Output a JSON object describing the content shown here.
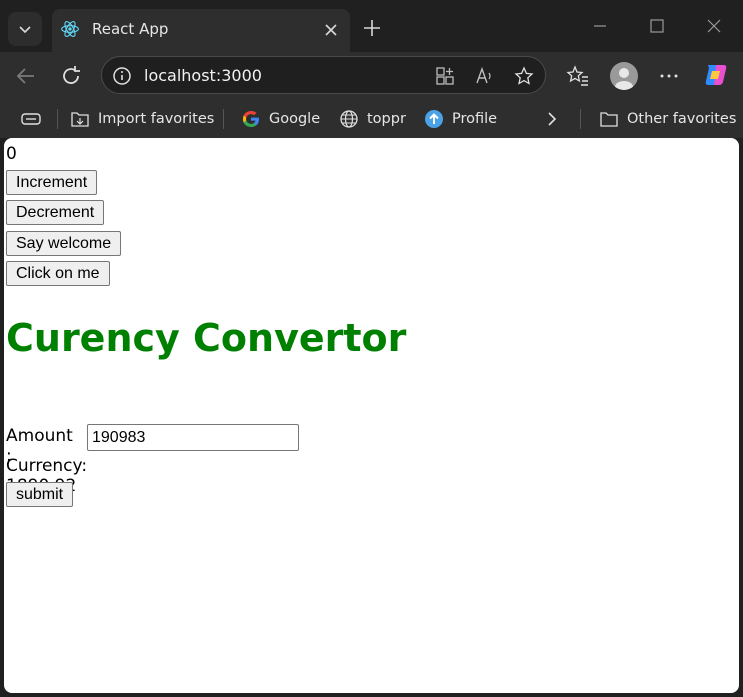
{
  "browser": {
    "tab_title": "React App",
    "url": "localhost:3000",
    "favorites": [
      {
        "label": "Import favorites",
        "icon": "import-favorites-icon"
      },
      {
        "label": "Google",
        "icon": "google-icon"
      },
      {
        "label": "toppr",
        "icon": "globe-icon"
      },
      {
        "label": "Profile",
        "icon": "profile-upload-icon"
      }
    ],
    "other_favorites": "Other favorites"
  },
  "app": {
    "counter_value": "0",
    "buttons": {
      "increment": "Increment",
      "decrement": "Decrement",
      "say_welcome": "Say welcome",
      "click_on_me": "Click on me"
    },
    "converter": {
      "title": "Curency Convertor",
      "amount_label": "Amount :",
      "amount_value": "190983",
      "currency_text": "Currency: 1890.92",
      "submit_label": "submit"
    }
  },
  "colors": {
    "heading": "#008000",
    "chrome_bg": "#202020",
    "toolbar_bg": "#2e2e2e"
  }
}
